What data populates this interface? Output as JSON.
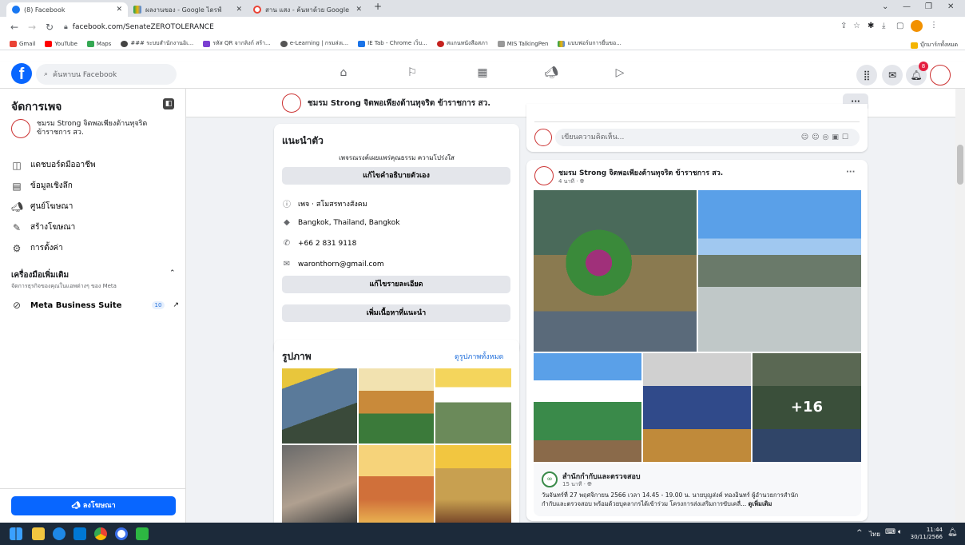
{
  "browser": {
    "tabs": [
      {
        "title": "(8) Facebook"
      },
      {
        "title": "ผลงานของ - Google ไดรฟ์"
      },
      {
        "title": "สาน แสง - ค้นหาด้วย Google"
      }
    ],
    "url": "facebook.com/SenateZEROTOLERANCE",
    "bookmarks": [
      "Gmail",
      "YouTube",
      "Maps",
      "### ระบบสำนักงานอิเ...",
      "รหัส QR จากลิงก์ สร้า...",
      "e-Learning | กรมส่งเ...",
      "IE Tab - Chrome เว็บ...",
      "สแกนหนังสือสภา",
      "MIS TalkingPen",
      "แบบฟอร์มการยื่นขอ..."
    ],
    "other_bookmarks": "บุ๊กมาร์กทั้งหมด"
  },
  "fb": {
    "search_placeholder": "ค้นหาบน Facebook",
    "notif_count": "8"
  },
  "sidebar": {
    "title": "จัดการเพจ",
    "page_name": "ชมรม Strong จิตพอเพียงต้านทุจริต ข้าราชการ สว.",
    "items": [
      "แดชบอร์ดมืออาชีพ",
      "ข้อมูลเชิงลึก",
      "ศูนย์โฆษณา",
      "สร้างโฆษณา",
      "การตั้งค่า"
    ],
    "tools_title": "เครื่องมือเพิ่มเติม",
    "tools_sub": "จัดการธุรกิจของคุณในแอพต่างๆ ของ Meta",
    "meta_suite": "Meta Business Suite",
    "meta_count": "10",
    "promote_btn": "ลงโฆษณา"
  },
  "header": {
    "page_name": "ชมรม Strong จิตพอเพียงต้านทุจริต ข้าราชการ สว.",
    "more": "···"
  },
  "intro": {
    "title": "แนะนำตัว",
    "bio": "เพจรณรงค์เผยแพร่คุณธรรม ความโปร่งใส",
    "edit_bio": "แก้ไขคำอธิบายตัวเอง",
    "category": "เพจ · สโมสรทางสังคม",
    "location": "Bangkok, Thailand, Bangkok",
    "phone": "+66 2 831 9118",
    "email": "waronthorn@gmail.com",
    "edit_details": "แก้ไขรายละเอียด",
    "add_featured": "เพิ่มเนื้อหาที่แนะนำ"
  },
  "photos": {
    "title": "รูปภาพ",
    "see_all": "ดูรูปภาพทั้งหมด"
  },
  "feed": {
    "comment_placeholder": "เขียนความคิดเห็น...",
    "post_author": "ชมรม Strong จิตพอเพียงต้านทุจริต ข้าราชการ สว.",
    "post_time": "4 นาที · ",
    "more_photos": "+16",
    "shared_author": "สำนักกำกับและตรวจสอบ",
    "shared_time": "15 นาที · ",
    "shared_text": "วันจันทร์ที่ 27 พฤศจิกายน 2566 เวลา 14.45 - 19.00 น. นายบุญส่งค์ ทองอินทร์ ผู้อำนวยการสำนัก",
    "shared_text2": "กำกับและตรวจสอบ พร้อมด้วยบุคลากรได้เข้าร่วม โครงการส่งเสริมการขับเคลื่... ",
    "see_more": "ดูเพิ่มเติม"
  },
  "taskbar": {
    "lang": "ไทย",
    "time": "11:44",
    "date": "30/11/2566"
  },
  "colors": {
    "fb_blue": "#0866ff",
    "link": "#216fdb"
  }
}
